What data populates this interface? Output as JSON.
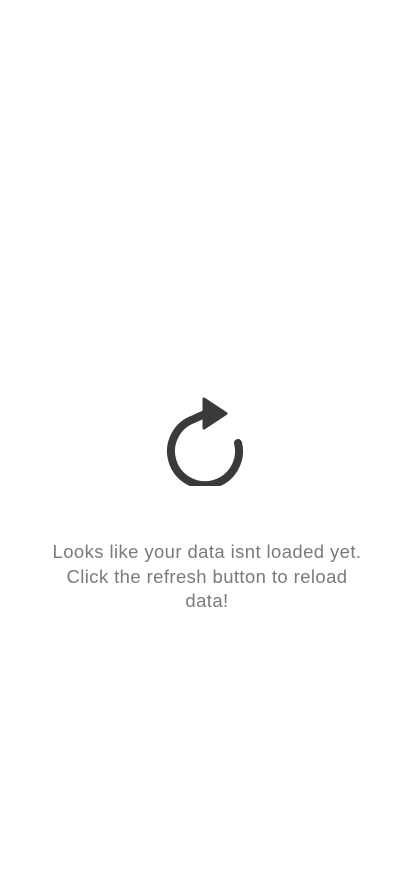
{
  "empty_state": {
    "icon": "refresh-icon",
    "icon_color": "#3a3a3a",
    "message": "Looks like your data isnt loaded yet. Click the refresh button to reload data!",
    "message_color": "#7a7a7a",
    "background": "#ffffff"
  }
}
